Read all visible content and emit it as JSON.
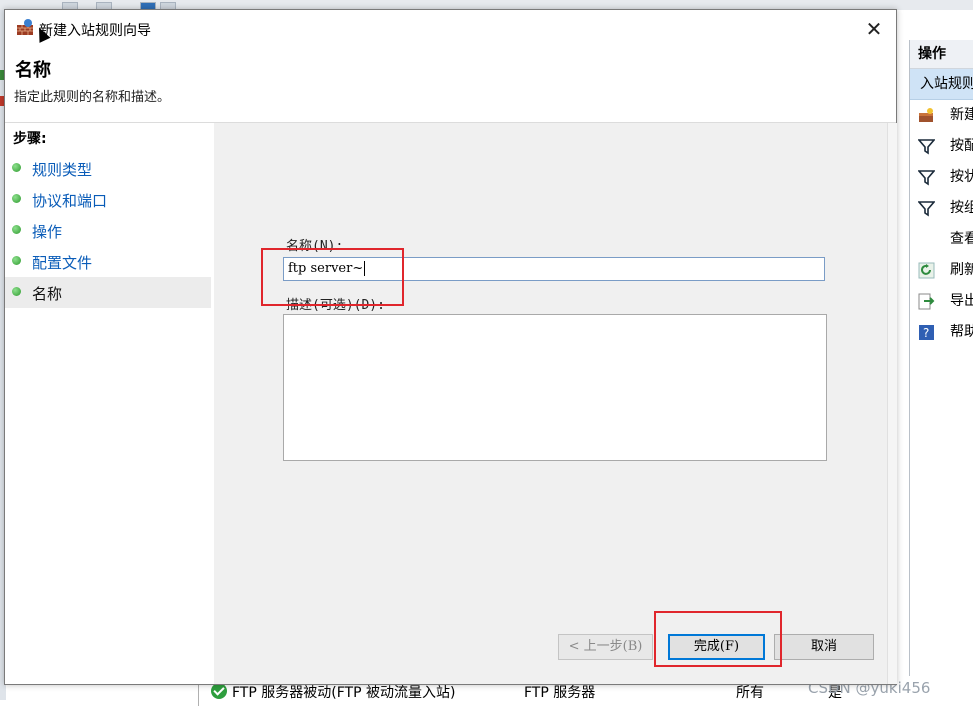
{
  "dialog": {
    "title": "新建入站规则向导",
    "close_glyph": "✕",
    "header_title": "名称",
    "header_desc": "指定此规则的名称和描述。"
  },
  "steps": {
    "label": "步骤:",
    "items": [
      {
        "label": "规则类型",
        "current": false
      },
      {
        "label": "协议和端口",
        "current": false
      },
      {
        "label": "操作",
        "current": false
      },
      {
        "label": "配置文件",
        "current": false
      },
      {
        "label": "名称",
        "current": true
      }
    ]
  },
  "form": {
    "name_label": "名称(N):",
    "name_value": "ftp server~",
    "desc_label": "描述(可选)(D):",
    "desc_value": ""
  },
  "buttons": {
    "back": "< 上一步(B)",
    "finish": "完成(F)",
    "cancel": "取消"
  },
  "actions_panel": {
    "header": "操作",
    "selected": "入站规则",
    "items": [
      {
        "label": "新建",
        "icon": "new-rule-icon"
      },
      {
        "label": "按配",
        "icon": "filter-icon"
      },
      {
        "label": "按状",
        "icon": "filter-icon"
      },
      {
        "label": "按组",
        "icon": "filter-icon"
      },
      {
        "label": "查看",
        "icon": ""
      },
      {
        "label": "刷新",
        "icon": "refresh-icon"
      },
      {
        "label": "导出",
        "icon": "export-icon"
      },
      {
        "label": "帮助",
        "icon": "help-icon"
      }
    ]
  },
  "rule_row": {
    "name": "FTP 服务器被动(FTP 被动流量入站)",
    "group": "FTP 服务器",
    "profile": "所有",
    "enabled": "是"
  },
  "watermark": "CSDN @yuki456",
  "colors": {
    "highlight_box": "#e0262c",
    "step_link": "#0a5cb8",
    "selected_action": "#cfe3f6"
  }
}
